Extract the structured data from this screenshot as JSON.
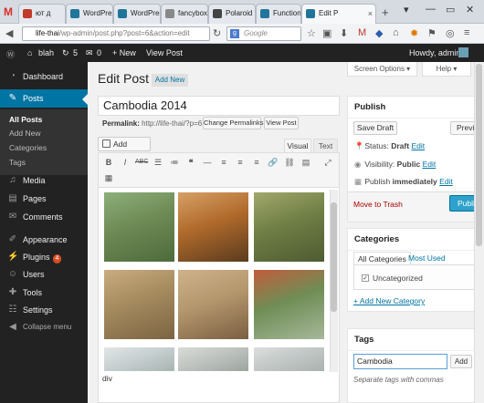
{
  "browser": {
    "tabs": [
      {
        "label": "ют д",
        "fav_color": "#c0392b"
      },
      {
        "label": "WordPres",
        "fav_color": "#21759b"
      },
      {
        "label": "WordPres",
        "fav_color": "#21759b"
      },
      {
        "label": "fancybox",
        "fav_color": "#888888"
      },
      {
        "label": "Polaroid",
        "fav_color": "#444444"
      },
      {
        "label": "Function",
        "fav_color": "#21759b"
      },
      {
        "label": "Edit P",
        "fav_color": "#21759b"
      }
    ],
    "url_host": "life-thai",
    "url_path": "/wp-admin/post.php?post=6&action=edit",
    "search_placeholder": "Google"
  },
  "adminbar": {
    "site_name": "blah",
    "updates_count": "5",
    "comments_count": "0",
    "new_label": "+ New",
    "view_post": "View Post",
    "howdy": "Howdy, admin"
  },
  "sidebar": {
    "items": [
      {
        "label": "Dashboard",
        "icon": "dashboard-icon"
      },
      {
        "label": "Posts",
        "icon": "pin-icon"
      },
      {
        "label": "Media",
        "icon": "media-icon"
      },
      {
        "label": "Pages",
        "icon": "page-icon"
      },
      {
        "label": "Comments",
        "icon": "comment-icon"
      },
      {
        "label": "Appearance",
        "icon": "brush-icon"
      },
      {
        "label": "Plugins",
        "icon": "plug-icon",
        "badge": "4"
      },
      {
        "label": "Users",
        "icon": "user-icon"
      },
      {
        "label": "Tools",
        "icon": "wrench-icon"
      },
      {
        "label": "Settings",
        "icon": "settings-icon"
      },
      {
        "label": "Collapse menu",
        "icon": "collapse-icon"
      }
    ],
    "submenu": [
      "All Posts",
      "Add New",
      "Categories",
      "Tags"
    ]
  },
  "main": {
    "screen_options": "Screen Options ▾",
    "help": "Help ▾",
    "page_title": "Edit Post",
    "add_new": "Add New",
    "post_title": "Cambodia 2014",
    "permalink_label": "Permalink:",
    "permalink_url": "http://life-thai/?p=6",
    "change_permalinks": "Change Permalinks",
    "view_post": "View Post",
    "add_media": "Add Media",
    "tab_visual": "Visual",
    "tab_text": "Text",
    "path_label": "div",
    "photos": [
      {
        "name": "photo-floating-houses",
        "colors": [
          "#6e8a55",
          "#8db07a",
          "#4d6b3b"
        ]
      },
      {
        "name": "photo-girl-on-roots",
        "colors": [
          "#b06a2b",
          "#d7a066",
          "#5a3b1e"
        ]
      },
      {
        "name": "photo-village-trees",
        "colors": [
          "#6f7f45",
          "#a3a86d",
          "#4e5b32"
        ]
      },
      {
        "name": "photo-floating-boat",
        "colors": [
          "#a58a5e",
          "#c9ad7f",
          "#7b6443"
        ]
      },
      {
        "name": "photo-girl-with-pig",
        "colors": [
          "#b5976e",
          "#cfb28a",
          "#7a5f41"
        ]
      },
      {
        "name": "photo-aerial-village",
        "colors": [
          "#6f8d55",
          "#c25d3c",
          "#a6b89a"
        ]
      },
      {
        "name": "photo-strip-1",
        "colors": [
          "#c8d0d2",
          "#e2e6e4",
          "#a9b4b0"
        ]
      },
      {
        "name": "photo-strip-2",
        "colors": [
          "#bfc4c0",
          "#d9dcd6",
          "#9da59f"
        ]
      },
      {
        "name": "photo-strip-3",
        "colors": [
          "#c3c9c8",
          "#dcdfdc",
          "#aab2ad"
        ]
      }
    ]
  },
  "publish": {
    "title": "Publish",
    "save_draft": "Save Draft",
    "preview": "Previ",
    "status_label": "Status:",
    "status_value": "Draft",
    "visibility_label": "Visibility:",
    "visibility_value": "Public",
    "publish_label": "Publish",
    "publish_value": "immediately",
    "edit": "Edit",
    "trash": "Move to Trash",
    "publish_btn": "Publi"
  },
  "categories": {
    "title": "Categories",
    "tab_all": "All Categories",
    "tab_used": "Most Used",
    "item": "Uncategorized",
    "add_link": "+ Add New Category"
  },
  "tags": {
    "title": "Tags",
    "input_value": "Cambodia",
    "add_btn": "Add",
    "hint": "Separate tags with commas"
  },
  "colors": {
    "accent": "#0074a2",
    "admin_dark": "#222222",
    "publish_blue": "#2ea2cc",
    "trash_red": "#aa0000"
  }
}
